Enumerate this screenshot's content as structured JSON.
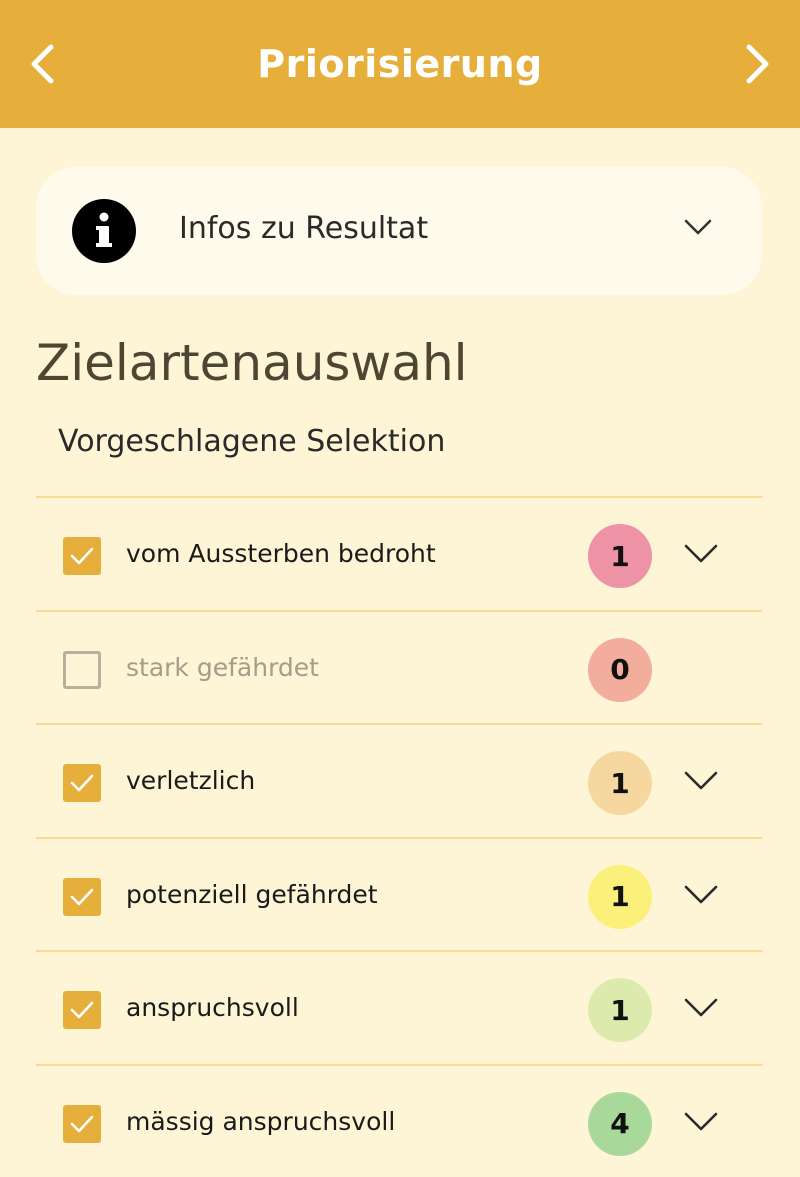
{
  "header": {
    "title": "Priorisierung",
    "back_icon": "chevron-left-icon",
    "forward_icon": "chevron-right-icon",
    "color": "#e6ae3a"
  },
  "info_card": {
    "label": "Infos zu Resultat",
    "icon": "info-icon",
    "chevron": "chevron-down-icon"
  },
  "section": {
    "title": "Zielartenauswahl",
    "subtitle": "Vorgeschlagene Selektion"
  },
  "categories": [
    {
      "label": "vom Aussterben bedroht",
      "checked": true,
      "count": "1",
      "badge_color": "#ee93a5",
      "expandable": true
    },
    {
      "label": "stark gefährdet",
      "checked": false,
      "count": "0",
      "badge_color": "#f2ad9c",
      "expandable": false
    },
    {
      "label": "verletzlich",
      "checked": true,
      "count": "1",
      "badge_color": "#f7d7a0",
      "expandable": true
    },
    {
      "label": "potenziell gefährdet",
      "checked": true,
      "count": "1",
      "badge_color": "#fbf17a",
      "expandable": true
    },
    {
      "label": "anspruchsvoll",
      "checked": true,
      "count": "1",
      "badge_color": "#dcebad",
      "expandable": true
    },
    {
      "label": "mässig anspruchsvoll",
      "checked": true,
      "count": "4",
      "badge_color": "#a9d99a",
      "expandable": true
    }
  ]
}
